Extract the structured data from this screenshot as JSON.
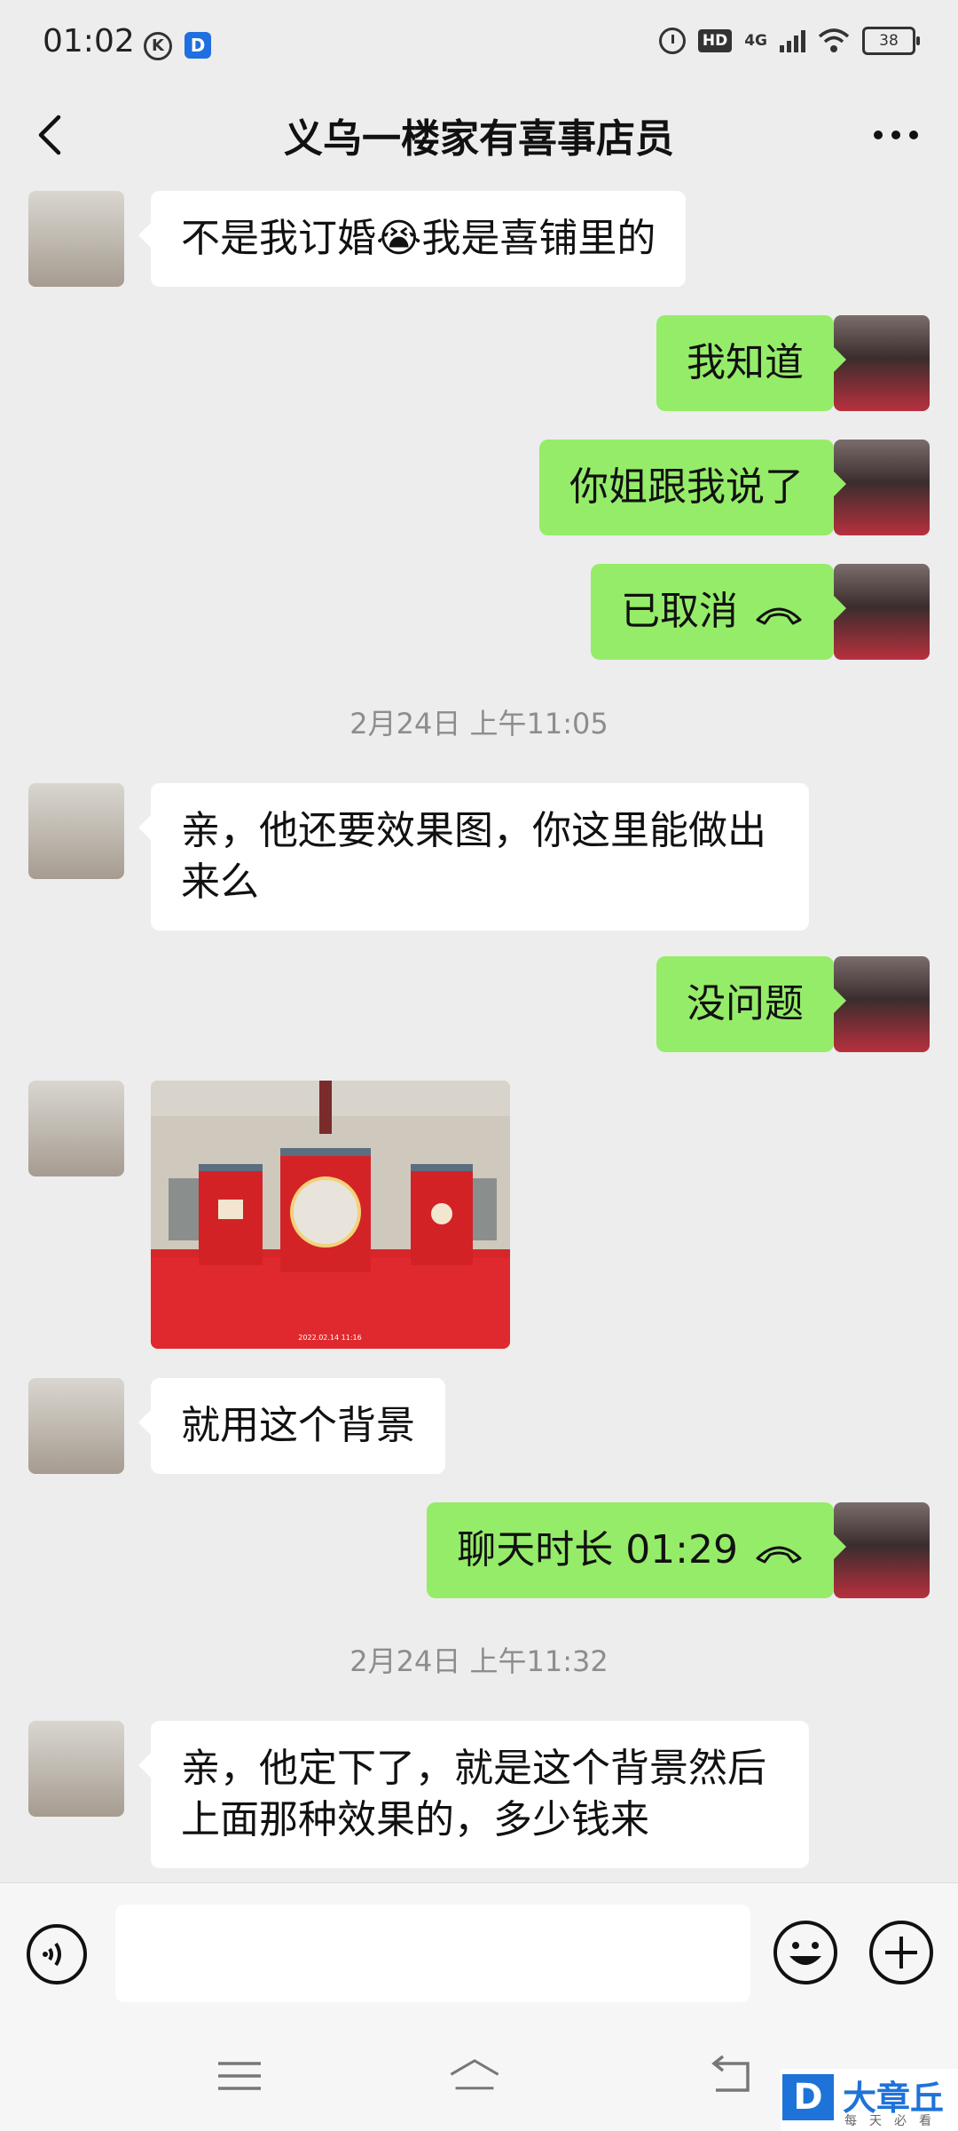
{
  "status_bar": {
    "time": "01:02",
    "k_badge": "K",
    "d_badge": "D",
    "hd_badge": "HD",
    "network": "4G",
    "battery": "38"
  },
  "header": {
    "title": "义乌一楼家有喜事店员",
    "back_icon": "chevron-left-icon",
    "more_icon": "more-dots-icon"
  },
  "messages": [
    {
      "side": "recv",
      "type": "text",
      "text": "不是我订婚😭我是喜铺里的"
    },
    {
      "side": "sent",
      "type": "text",
      "text": "我知道"
    },
    {
      "side": "sent",
      "type": "text",
      "text": "你姐跟我说了"
    },
    {
      "side": "sent",
      "type": "call",
      "text": "已取消"
    },
    {
      "type": "timestamp",
      "text": "2月24日 上午11:05"
    },
    {
      "side": "recv",
      "type": "text",
      "text": "亲，他还要效果图，你这里能做出来么"
    },
    {
      "side": "sent",
      "type": "text",
      "text": "没问题"
    },
    {
      "side": "recv",
      "type": "image",
      "caption": "2022.02.14 11:16"
    },
    {
      "side": "recv",
      "type": "text",
      "text": "就用这个背景"
    },
    {
      "side": "sent",
      "type": "call",
      "text": "聊天时长 01:29"
    },
    {
      "type": "timestamp",
      "text": "2月24日 上午11:32"
    },
    {
      "side": "recv",
      "type": "text",
      "text": "亲，他定下了，就是这个背景然后上面那种效果的，多少钱来"
    }
  ],
  "input_bar": {
    "voice_icon": "voice-icon",
    "emoji_icon": "emoji-icon",
    "plus_icon": "plus-icon",
    "placeholder": ""
  },
  "system_nav": {
    "menu_icon": "menu-icon",
    "home_icon": "home-icon",
    "back_icon": "back-arrow-icon"
  },
  "watermark": {
    "logo_letter": "D",
    "name": "大章丘",
    "slogan": "每天必看"
  },
  "colors": {
    "sent_bubble": "#95ec69",
    "recv_bubble": "#ffffff",
    "background": "#ededed",
    "brand_blue": "#1e73d8"
  }
}
